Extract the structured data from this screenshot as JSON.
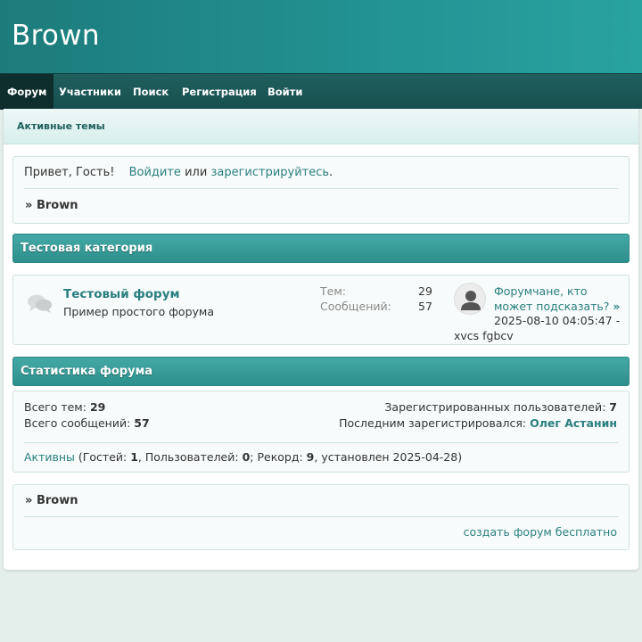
{
  "site": {
    "title": "Brown"
  },
  "nav": {
    "items": [
      {
        "label": "Форум"
      },
      {
        "label": "Участники"
      },
      {
        "label": "Поиск"
      },
      {
        "label": "Регистрация"
      },
      {
        "label": "Войти"
      }
    ]
  },
  "subnav": {
    "active_topics": "Активные темы"
  },
  "welcome": {
    "greeting": "Привет, Гость!",
    "login_link": "Войдите",
    "or_text": "или",
    "register_link": "зарегистрируйтесь",
    "period": "."
  },
  "breadcrumb": {
    "prefix": "»",
    "label": "Brown"
  },
  "category": {
    "title": "Тестовая категория",
    "forum": {
      "title": "Тестовый форум",
      "description": "Пример простого форума",
      "topics_label": "Тем:",
      "topics_value": "29",
      "posts_label": "Сообщений:",
      "posts_value": "57",
      "last_post_title": "Форумчане, кто может подсказать?",
      "last_post_arrow": "»",
      "last_post_date": "2025-08-10 04:05:47 -",
      "last_post_author": "xvcs fgbcv"
    }
  },
  "stats": {
    "header": "Статистика форума",
    "total_topics_label": "Всего тем:",
    "total_topics": "29",
    "total_posts_label": "Всего сообщений:",
    "total_posts": "57",
    "registered_label": "Зарегистрированных пользователей:",
    "registered": "7",
    "last_registered_label": "Последним зарегистрировался:",
    "last_registered": "Олег Астанин",
    "online_link": "Активны",
    "online_guests_label": "(Гостей:",
    "online_guests": "1",
    "online_users_label": ", Пользователей:",
    "online_users": "0",
    "online_record_label": "; Рекорд:",
    "online_record": "9",
    "online_record_date": ", установлен 2025-04-28)"
  },
  "footer": {
    "create_forum": "создать форум бесплатно"
  }
}
